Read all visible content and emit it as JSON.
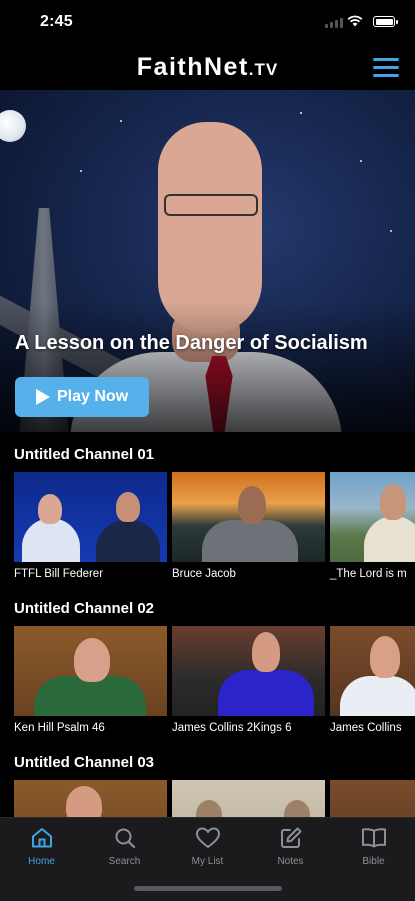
{
  "status": {
    "time": "2:45"
  },
  "header": {
    "brand": "FaithNet",
    "brand_suffix": ".TV"
  },
  "hero": {
    "title": "A Lesson on the Danger of Socialism",
    "play_label": "Play Now"
  },
  "channels": [
    {
      "title": "Untitled Channel 01",
      "items": [
        {
          "caption": "FTFL  Bill Federer"
        },
        {
          "caption": "Bruce Jacob"
        },
        {
          "caption": "_The Lord is m"
        }
      ]
    },
    {
      "title": "Untitled Channel 02",
      "items": [
        {
          "caption": "Ken Hill Psalm 46"
        },
        {
          "caption": "James Collins 2Kings 6"
        },
        {
          "caption": "James Collins"
        }
      ]
    },
    {
      "title": "Untitled Channel 03",
      "items": []
    }
  ],
  "tabs": [
    {
      "label": "Home",
      "icon": "home-icon",
      "active": true
    },
    {
      "label": "Search",
      "icon": "search-icon"
    },
    {
      "label": "My List",
      "icon": "heart-icon"
    },
    {
      "label": "Notes",
      "icon": "note-edit-icon"
    },
    {
      "label": "Bible",
      "icon": "book-icon"
    }
  ],
  "colors": {
    "accent": "#3fa3e6",
    "play_button": "#56b1ea",
    "background": "#000000",
    "tabbar": "#1b1b1d"
  }
}
